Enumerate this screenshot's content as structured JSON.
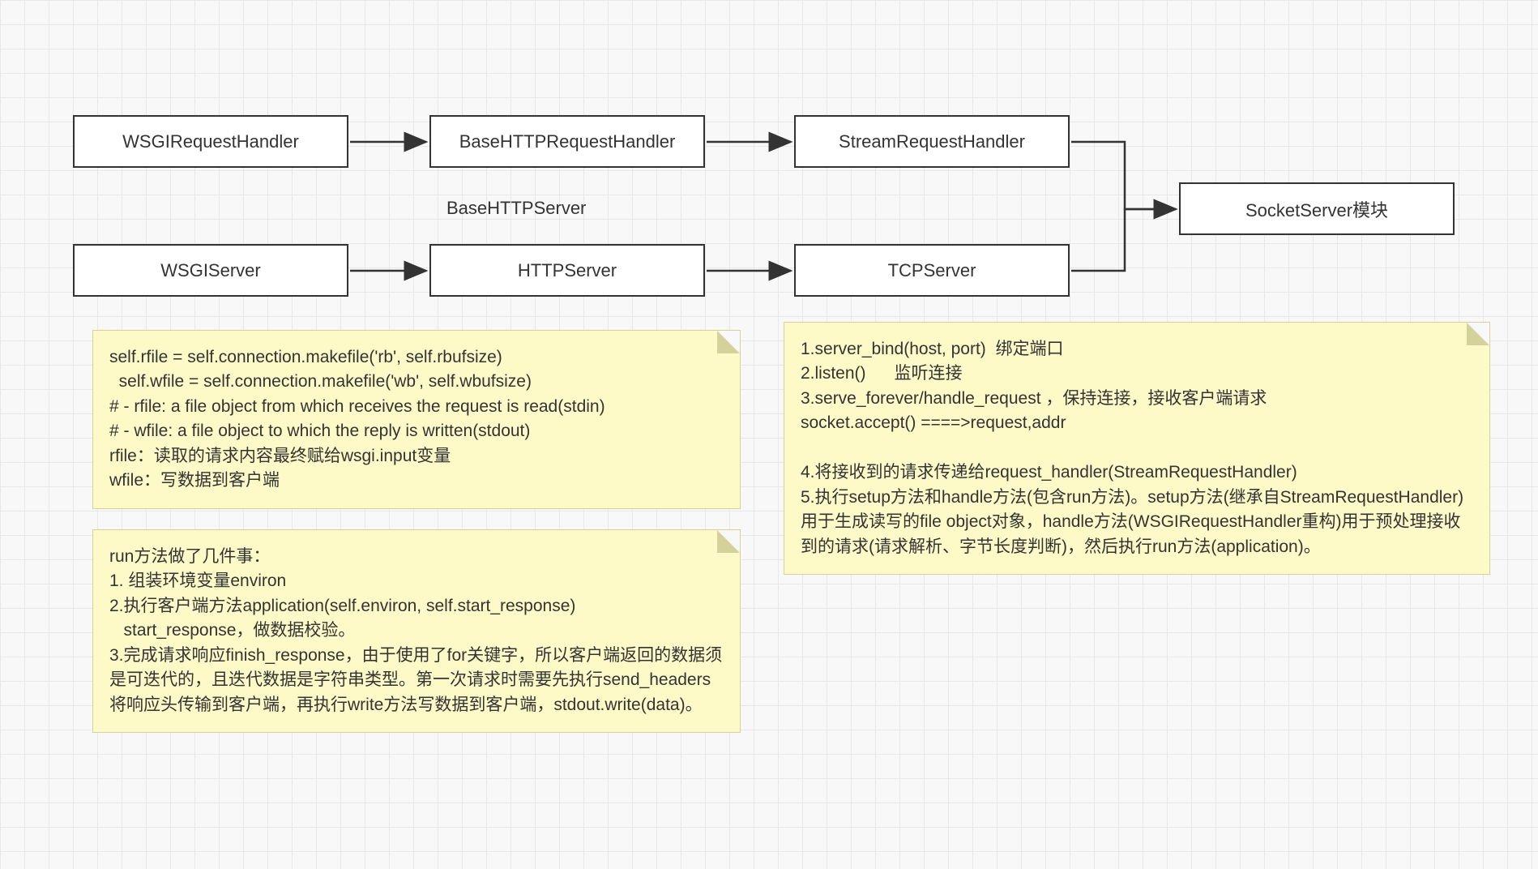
{
  "boxes": {
    "wsgiRequestHandler": "WSGIRequestHandler",
    "baseHTTPRequestHandler": "BaseHTTPRequestHandler",
    "streamRequestHandler": "StreamRequestHandler",
    "socketServerModule": "SocketServer模块",
    "wsgiServer": "WSGIServer",
    "httpServer": "HTTPServer",
    "tcpServer": "TCPServer"
  },
  "labels": {
    "baseHTTPServer": "BaseHTTPServer"
  },
  "notes": {
    "note1": "self.rfile = self.connection.makefile('rb', self.rbufsize)\n  self.wfile = self.connection.makefile('wb', self.wbufsize)\n# - rfile: a file object from which receives the request is read(stdin)\n# - wfile: a file object to which the reply is written(stdout)\nrfile：读取的请求内容最终赋给wsgi.input变量\nwfile：写数据到客户端",
    "note2": "run方法做了几件事：\n1. 组装环境变量environ\n2.执行客户端方法application(self.environ, self.start_response)\n   start_response，做数据校验。\n3.完成请求响应finish_response，由于使用了for关键字，所以客户端返回的数据须是可迭代的，且迭代数据是字符串类型。第一次请求时需要先执行send_headers将响应头传输到客户端，再执行write方法写数据到客户端，stdout.write(data)。",
    "note3": "1.server_bind(host, port)  绑定端口\n2.listen()      监听连接\n3.serve_forever/handle_request ，保持连接，接收客户端请求\nsocket.accept() ====>request,addr\n\n4.将接收到的请求传递给request_handler(StreamRequestHandler)\n5.执行setup方法和handle方法(包含run方法)。setup方法(继承自StreamRequestHandler)用于生成读写的file object对象，handle方法(WSGIRequestHandler重构)用于预处理接收到的请求(请求解析、字节长度判断)，然后执行run方法(application)。"
  }
}
